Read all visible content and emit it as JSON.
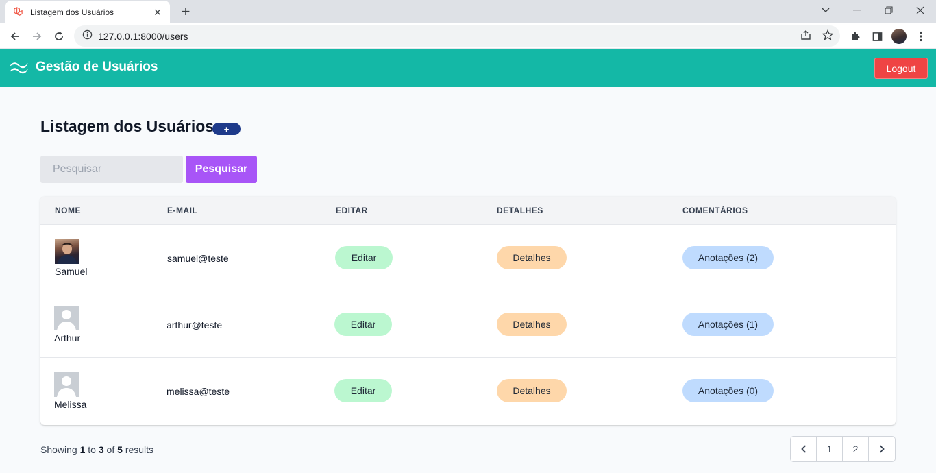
{
  "browser": {
    "tab_title": "Listagem dos Usuários",
    "url": "127.0.0.1:8000/users",
    "icons": [
      "laravel-icon",
      "close-icon",
      "plus-icon",
      "chevron-down-icon",
      "minimize-icon",
      "restore-icon",
      "close-window-icon",
      "back-icon",
      "forward-icon",
      "reload-icon",
      "info-icon",
      "share-icon",
      "star-icon",
      "extensions-icon",
      "side-panel-icon",
      "profile-avatar",
      "menu-icon"
    ]
  },
  "header": {
    "title": "Gestão de Usuários",
    "logout_label": "Logout",
    "color": "#14b8a6"
  },
  "main": {
    "title": "Listagem dos Usuários",
    "add_label": "+",
    "search_placeholder": "Pesquisar",
    "search_value": "",
    "search_button": "Pesquisar",
    "table": {
      "columns": [
        "NOME",
        "E-MAIL",
        "EDITAR",
        "DETALHES",
        "COMENTÁRIOS"
      ],
      "rows": [
        {
          "name": "Samuel",
          "email": "samuel@teste",
          "edit": "Editar",
          "details": "Detalhes",
          "notes": "Anotações (2)",
          "avatar": "photo"
        },
        {
          "name": "Arthur",
          "email": "arthur@teste",
          "edit": "Editar",
          "details": "Detalhes",
          "notes": "Anotações (1)",
          "avatar": "default"
        },
        {
          "name": "Melissa",
          "email": "melissa@teste",
          "edit": "Editar",
          "details": "Detalhes",
          "notes": "Anotações (0)",
          "avatar": "default"
        }
      ]
    },
    "summary": {
      "prefix": "Showing",
      "from": "1",
      "to_word": "to",
      "to": "3",
      "of_word": "of",
      "total": "5",
      "suffix": "results"
    },
    "pagination": {
      "pages": [
        "1",
        "2"
      ]
    }
  }
}
